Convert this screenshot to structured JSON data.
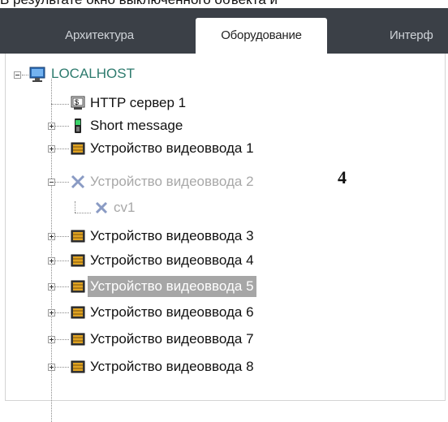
{
  "caption": "В результате окно выключенного объекта и",
  "tabs": [
    {
      "label": "Архитектура",
      "active": false
    },
    {
      "label": "Оборудование",
      "active": true
    },
    {
      "label": "Интерф",
      "active": false
    }
  ],
  "tree": {
    "root": {
      "label": "LOCALHOST",
      "expanded": true,
      "icon": "computer-icon"
    },
    "children": [
      {
        "label": "HTTP сервер 1",
        "icon": "http-server-icon",
        "expander": "none"
      },
      {
        "label": "Short message",
        "icon": "phone-icon",
        "expander": "plus"
      },
      {
        "label": "Устройство видеоввода 1",
        "icon": "video-device-icon",
        "expander": "plus"
      },
      {
        "label": "Устройство видеоввода 2",
        "icon": "disabled-x-icon",
        "expander": "minus",
        "disabled": true,
        "children": [
          {
            "label": "cv1",
            "icon": "disabled-x-icon",
            "disabled": true
          }
        ]
      },
      {
        "label": "Устройство видеоввода 3",
        "icon": "video-device-icon",
        "expander": "plus"
      },
      {
        "label": "Устройство видеоввода 4",
        "icon": "video-device-icon",
        "expander": "plus"
      },
      {
        "label": "Устройство видеоввода 5",
        "icon": "video-device-icon",
        "expander": "plus",
        "selected": true
      },
      {
        "label": "Устройство видеоввода 6",
        "icon": "video-device-icon",
        "expander": "plus"
      },
      {
        "label": "Устройство видеоввода 7",
        "icon": "video-device-icon",
        "expander": "plus"
      },
      {
        "label": "Устройство видеоввода 8",
        "icon": "video-device-icon",
        "expander": "plus"
      }
    ]
  },
  "annotation": "4"
}
